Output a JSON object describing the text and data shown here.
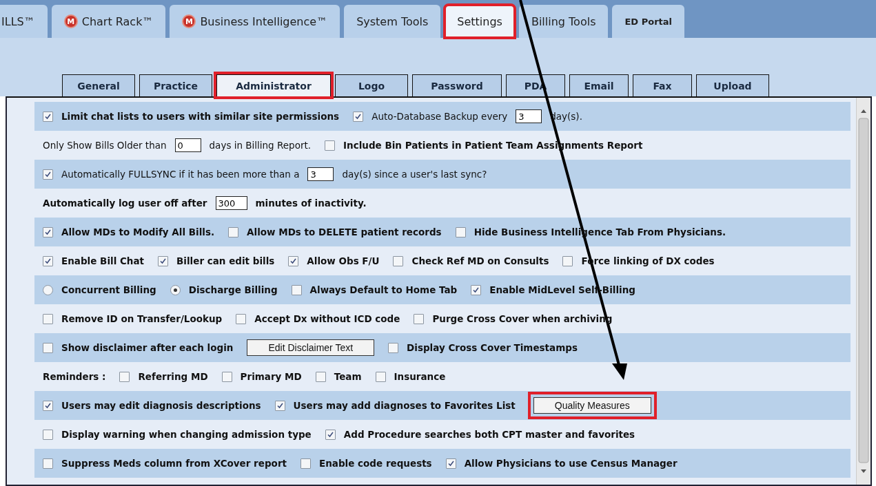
{
  "main_tabs": [
    {
      "label": "ILLS™",
      "selected": false,
      "highlighted": false
    },
    {
      "label": "Chart Rack™",
      "logo": "M",
      "selected": false,
      "highlighted": false
    },
    {
      "label": "Business Intelligence™",
      "logo": "M",
      "selected": false,
      "highlighted": false
    },
    {
      "label": "System Tools",
      "selected": false,
      "highlighted": false
    },
    {
      "label": "Settings",
      "selected": true,
      "highlighted": true
    },
    {
      "label": "Billing Tools",
      "selected": false,
      "highlighted": false
    },
    {
      "label": "ED Portal",
      "selected": false,
      "highlighted": false,
      "small": true
    }
  ],
  "sub_tabs": [
    {
      "label": "General",
      "selected": false,
      "highlighted": false
    },
    {
      "label": "Practice",
      "selected": false,
      "highlighted": false
    },
    {
      "label": "Administrator",
      "selected": true,
      "highlighted": true
    },
    {
      "label": "Logo",
      "selected": false,
      "highlighted": false
    },
    {
      "label": "Password",
      "selected": false,
      "highlighted": false
    },
    {
      "label": "PDA",
      "selected": false,
      "highlighted": false
    },
    {
      "label": "Email",
      "selected": false,
      "highlighted": false
    },
    {
      "label": "Fax",
      "selected": false,
      "highlighted": false
    },
    {
      "label": "Upload",
      "selected": false,
      "highlighted": false
    }
  ],
  "rows": [
    {
      "items": [
        {
          "kind": "checkbox",
          "label": "Limit chat lists to users with similar site permissions",
          "checked": true,
          "bold": true
        },
        {
          "kind": "checkbox",
          "label": "Auto-Database Backup every",
          "checked": true,
          "bold": false
        },
        {
          "kind": "input",
          "value": "3"
        },
        {
          "kind": "text",
          "text": "day(s).",
          "bold": false
        }
      ]
    },
    {
      "items": [
        {
          "kind": "text",
          "text": "Only Show Bills Older than",
          "bold": false
        },
        {
          "kind": "input",
          "value": "0"
        },
        {
          "kind": "text",
          "text": "days in Billing Report.",
          "bold": false
        },
        {
          "kind": "checkbox",
          "label": "Include Bin Patients in Patient Team Assignments Report",
          "checked": false,
          "bold": true
        }
      ]
    },
    {
      "items": [
        {
          "kind": "checkbox",
          "label": "Automatically FULLSYNC if it has been more than a",
          "checked": true,
          "bold": false
        },
        {
          "kind": "input",
          "value": "3"
        },
        {
          "kind": "text",
          "text": "day(s) since a user's last sync?",
          "bold": false
        }
      ]
    },
    {
      "items": [
        {
          "kind": "text",
          "text": "Automatically log user off after",
          "bold": true
        },
        {
          "kind": "input",
          "value": "300"
        },
        {
          "kind": "text",
          "text": "minutes of inactivity.",
          "bold": true
        }
      ]
    },
    {
      "items": [
        {
          "kind": "checkbox",
          "label": "Allow MDs to Modify All Bills.",
          "checked": true,
          "bold": true
        },
        {
          "kind": "checkbox",
          "label": "Allow MDs to DELETE patient records",
          "checked": false,
          "bold": true
        },
        {
          "kind": "checkbox",
          "label": "Hide Business Intelligence Tab From Physicians.",
          "checked": false,
          "bold": true
        }
      ]
    },
    {
      "items": [
        {
          "kind": "checkbox",
          "label": "Enable Bill Chat",
          "checked": true,
          "bold": true
        },
        {
          "kind": "checkbox",
          "label": "Biller can edit bills",
          "checked": true,
          "bold": true
        },
        {
          "kind": "checkbox",
          "label": "Allow Obs F/U",
          "checked": true,
          "bold": true
        },
        {
          "kind": "checkbox",
          "label": "Check Ref MD on Consults",
          "checked": false,
          "bold": true
        },
        {
          "kind": "checkbox",
          "label": "Force linking of DX codes",
          "checked": false,
          "bold": true
        }
      ]
    },
    {
      "items": [
        {
          "kind": "radio",
          "label": "Concurrent Billing",
          "selected": false,
          "bold": true
        },
        {
          "kind": "radio",
          "label": "Discharge Billing",
          "selected": true,
          "bold": true
        },
        {
          "kind": "checkbox",
          "label": "Always Default to Home Tab",
          "checked": false,
          "bold": true
        },
        {
          "kind": "checkbox",
          "label": "Enable MidLevel Self-Billing",
          "checked": true,
          "bold": true
        }
      ]
    },
    {
      "items": [
        {
          "kind": "checkbox",
          "label": "Remove ID on Transfer/Lookup",
          "checked": false,
          "bold": true
        },
        {
          "kind": "checkbox",
          "label": "Accept Dx without ICD code",
          "checked": false,
          "bold": true
        },
        {
          "kind": "checkbox",
          "label": "Purge Cross Cover when archiving",
          "checked": false,
          "bold": true
        }
      ]
    },
    {
      "items": [
        {
          "kind": "checkbox",
          "label": "Show disclaimer after each login",
          "checked": false,
          "bold": true
        },
        {
          "kind": "button",
          "label": "Edit Disclaimer Text",
          "highlighted": false
        },
        {
          "kind": "checkbox",
          "label": "Display Cross Cover Timestamps",
          "checked": false,
          "bold": true
        }
      ]
    },
    {
      "items": [
        {
          "kind": "text",
          "text": "Reminders :",
          "bold": true
        },
        {
          "kind": "checkbox",
          "label": "Referring MD",
          "checked": false,
          "bold": true
        },
        {
          "kind": "checkbox",
          "label": "Primary MD",
          "checked": false,
          "bold": true
        },
        {
          "kind": "checkbox",
          "label": "Team",
          "checked": false,
          "bold": true
        },
        {
          "kind": "checkbox",
          "label": "Insurance",
          "checked": false,
          "bold": true
        }
      ]
    },
    {
      "items": [
        {
          "kind": "checkbox",
          "label": "Users may edit diagnosis descriptions",
          "checked": true,
          "bold": true
        },
        {
          "kind": "checkbox",
          "label": "Users may add diagnoses to Favorites List",
          "checked": true,
          "bold": true
        },
        {
          "kind": "button",
          "label": "Quality Measures",
          "highlighted": true
        }
      ]
    },
    {
      "items": [
        {
          "kind": "checkbox",
          "label": "Display warning when changing admission type",
          "checked": false,
          "bold": true
        },
        {
          "kind": "checkbox",
          "label": "Add Procedure searches both CPT master and favorites",
          "checked": true,
          "bold": true
        }
      ]
    },
    {
      "items": [
        {
          "kind": "checkbox",
          "label": "Suppress Meds column from XCover report",
          "checked": false,
          "bold": true
        },
        {
          "kind": "checkbox",
          "label": "Enable code requests",
          "checked": false,
          "bold": true
        },
        {
          "kind": "checkbox",
          "label": "Allow Physicians to use Census Manager",
          "checked": true,
          "bold": true
        }
      ]
    }
  ]
}
